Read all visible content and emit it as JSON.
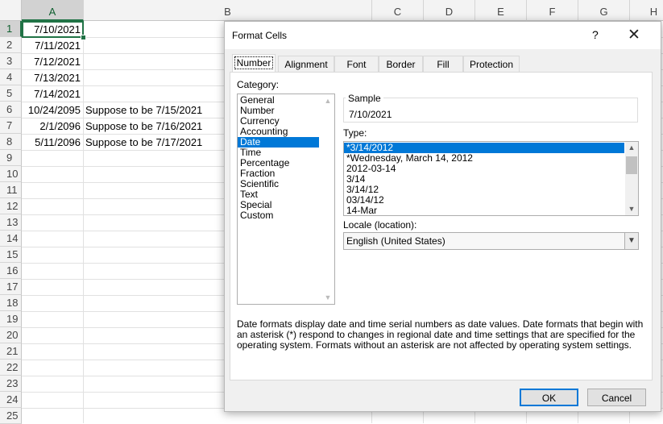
{
  "spreadsheet": {
    "columns": [
      "A",
      "B",
      "C",
      "D",
      "E",
      "F",
      "G",
      "H"
    ],
    "rows": [
      "1",
      "2",
      "3",
      "4",
      "5",
      "6",
      "7",
      "8",
      "9",
      "10",
      "11",
      "12",
      "13",
      "14",
      "15",
      "16",
      "17",
      "18",
      "19",
      "20",
      "21",
      "22",
      "23",
      "24",
      "25"
    ],
    "selected_column": "A",
    "selected_row": "1",
    "cells": [
      {
        "a": "7/10/2021",
        "b": ""
      },
      {
        "a": "7/11/2021",
        "b": ""
      },
      {
        "a": "7/12/2021",
        "b": ""
      },
      {
        "a": "7/13/2021",
        "b": ""
      },
      {
        "a": "7/14/2021",
        "b": ""
      },
      {
        "a": "10/24/2095",
        "b": "Suppose to be 7/15/2021"
      },
      {
        "a": "2/1/2096",
        "b": "Suppose to be 7/16/2021"
      },
      {
        "a": "5/11/2096",
        "b": "Suppose to be 7/17/2021"
      }
    ]
  },
  "dialog": {
    "title": "Format Cells",
    "help_label": "?",
    "close_label": "✕",
    "tabs": [
      "Number",
      "Alignment",
      "Font",
      "Border",
      "Fill",
      "Protection"
    ],
    "active_tab": "Number",
    "category_label": "Category:",
    "categories": [
      "General",
      "Number",
      "Currency",
      "Accounting",
      "Date",
      "Time",
      "Percentage",
      "Fraction",
      "Scientific",
      "Text",
      "Special",
      "Custom"
    ],
    "selected_category": "Date",
    "sample_label": "Sample",
    "sample_value": "7/10/2021",
    "type_label": "Type:",
    "types": [
      "*3/14/2012",
      "*Wednesday, March 14, 2012",
      "2012-03-14",
      "3/14",
      "3/14/12",
      "03/14/12",
      "14-Mar"
    ],
    "selected_type": "*3/14/2012",
    "locale_label": "Locale (location):",
    "locale_value": "English (United States)",
    "description": "Date formats display date and time serial numbers as date values.  Date formats that begin with an asterisk (*) respond to changes in regional date and time settings that are specified for the operating system. Formats without an asterisk are not affected by operating system settings.",
    "ok_label": "OK",
    "cancel_label": "Cancel",
    "accent_color": "#0078d7",
    "excel_green": "#217346"
  }
}
